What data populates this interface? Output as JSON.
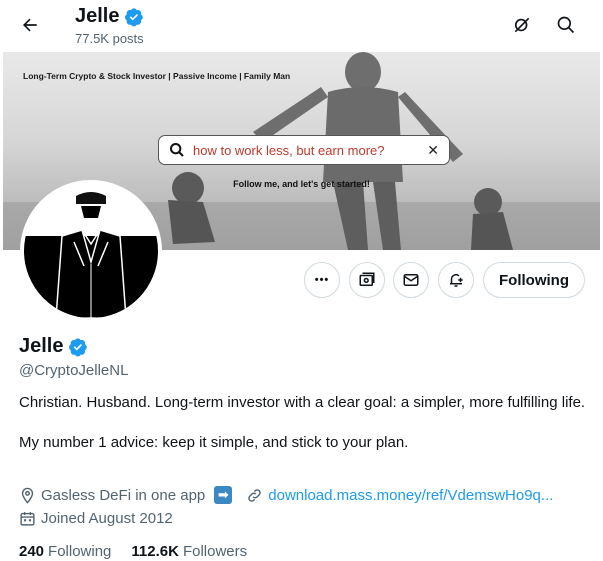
{
  "header": {
    "name": "Jelle",
    "posts": "77.5K posts",
    "icons": [
      "back-arrow-icon",
      "verified-badge-icon",
      "grok-icon",
      "search-icon"
    ]
  },
  "banner": {
    "tagline": "Long-Term Crypto & Stock Investor | Passive Income | Family Man",
    "search_text": "how to work less, but earn more?",
    "close_glyph": "✕",
    "cta": "Follow me, and let's get started!"
  },
  "actions": {
    "more_glyph": "•••",
    "follow_label": "Following",
    "icons": [
      "more-icon",
      "subscribe-icon",
      "message-icon",
      "notify-icon"
    ]
  },
  "profile": {
    "name": "Jelle",
    "handle": "@CryptoJelleNL",
    "bio_line1": "Christian. Husband. Long-term investor with a clear goal: a simpler, more fulfilling life.",
    "bio_line2": "My number 1 advice: keep it simple, and stick to your plan.",
    "location": "Gasless DeFi in one app",
    "location_emoji": "➡",
    "website": "download.mass.money/ref/VdemswHo9q...",
    "joined": "Joined August 2012"
  },
  "stats": {
    "following_count": "240",
    "following_label": "Following",
    "followers_count": "112.6K",
    "followers_label": "Followers"
  },
  "colors": {
    "accent": "#1d9bf0",
    "text": "#0f1419",
    "muted": "#536471",
    "border": "#cfd9de",
    "search_text": "#c0392b"
  }
}
